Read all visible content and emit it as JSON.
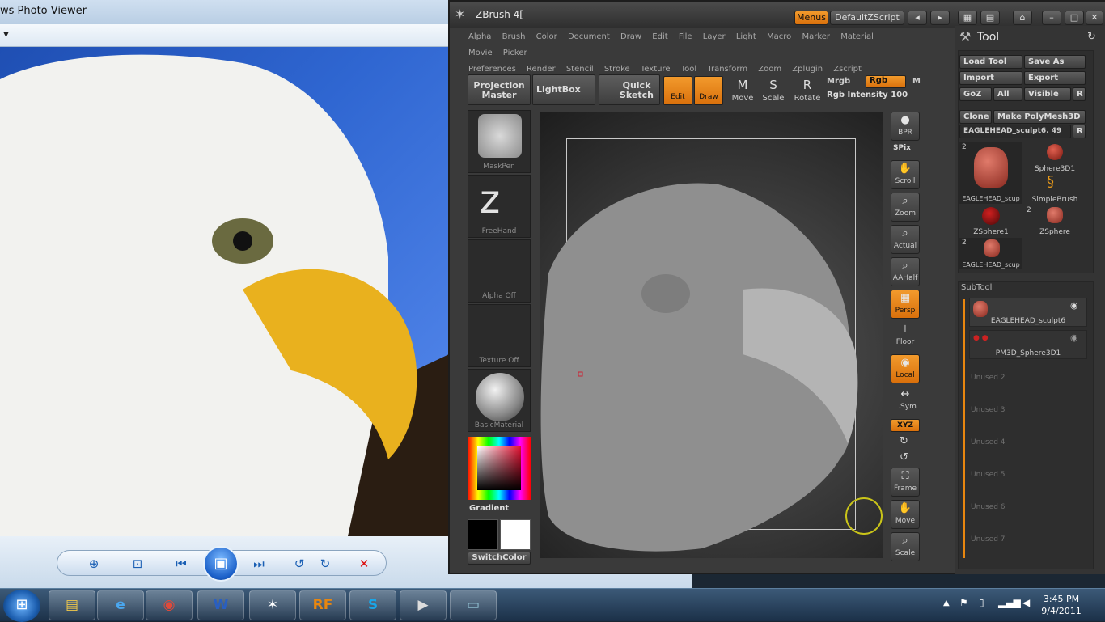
{
  "photo_viewer": {
    "title": "ws Photo Viewer",
    "controls": [
      "zoom-icon",
      "fit-icon",
      "previous-icon",
      "slideshow-icon",
      "next-icon",
      "rotate-ccw-icon",
      "rotate-cw-icon",
      "delete-icon"
    ]
  },
  "zbrush": {
    "title": "ZBrush 4[",
    "menus_label": "Menus",
    "script_label": "DefaultZScript",
    "menu_row1": [
      "Alpha",
      "Brush",
      "Color",
      "Document",
      "Draw",
      "Edit",
      "File",
      "Layer",
      "Light",
      "Macro",
      "Marker",
      "Material",
      "Movie",
      "Picker"
    ],
    "menu_row2": [
      "Preferences",
      "Render",
      "Stencil",
      "Stroke",
      "Texture",
      "Tool",
      "Transform",
      "Zoom",
      "Zplugin",
      "Zscript"
    ],
    "projection_master": "Projection Master",
    "lightbox": "LightBox",
    "quick_sketch": "Quick Sketch",
    "edit": "Edit",
    "draw": "Draw",
    "move": "Move",
    "scale": "Scale",
    "rotate": "Rotate",
    "mrgb": "Mrgb",
    "rgb": "Rgb",
    "m": "M",
    "rgb_intensity_label": "Rgb Intensity",
    "rgb_intensity_value": "100",
    "left_shelf": {
      "brush": "MaskPen",
      "stroke": "FreeHand",
      "alpha": "Alpha  Off",
      "texture": "Texture  Off",
      "material": "BasicMaterial",
      "gradient": "Gradient",
      "switch_color": "SwitchColor"
    },
    "right_shelf": [
      "BPR",
      "SPix",
      "Scroll",
      "Zoom",
      "Actual",
      "AAHalf",
      "Persp",
      "Floor",
      "Local",
      "L.Sym",
      "XYZ",
      "Frame",
      "Move",
      "Scale"
    ],
    "tool_palette": {
      "title": "Tool",
      "load_tool": "Load Tool",
      "save_as": "Save As",
      "import": "Import",
      "export": "Export",
      "goz": "GoZ",
      "all": "All",
      "visible": "Visible",
      "r": "R",
      "clone": "Clone",
      "make_polymesh": "Make PolyMesh3D",
      "current_tool": "EAGLEHEAD_sculpt6. 49",
      "thumbs": [
        {
          "label": "EAGLEHEAD_scup",
          "count": "2"
        },
        {
          "label": "Sphere3D1",
          "count": ""
        },
        {
          "label": "SimpleBrush",
          "count": ""
        },
        {
          "label": "ZSphere1",
          "count": ""
        },
        {
          "label": "ZSphere",
          "count": "2"
        },
        {
          "label": "EAGLEHEAD_scup",
          "count": "2"
        }
      ],
      "subtool_title": "SubTool",
      "subtools": [
        "EAGLEHEAD_sculpt6",
        "PM3D_Sphere3D1"
      ],
      "unused": [
        "Unused  2",
        "Unused  3",
        "Unused  4",
        "Unused  5",
        "Unused  6",
        "Unused  7"
      ]
    }
  },
  "taskbar": {
    "apps": [
      "explorer-icon",
      "ie-icon",
      "chrome-icon",
      "word-icon",
      "zbrush-icon",
      "rf-icon",
      "skype-icon",
      "movie-maker-icon",
      "photo-viewer-icon"
    ],
    "word_label": "W",
    "rf_label": "RF",
    "skype_label": "S",
    "time": "3:45 PM",
    "date": "9/4/2011"
  },
  "colors": {
    "zbrush_accent": "#e8860f",
    "panel_bg": "#3a3a3a",
    "taskbar_blue": "#2a4664"
  }
}
